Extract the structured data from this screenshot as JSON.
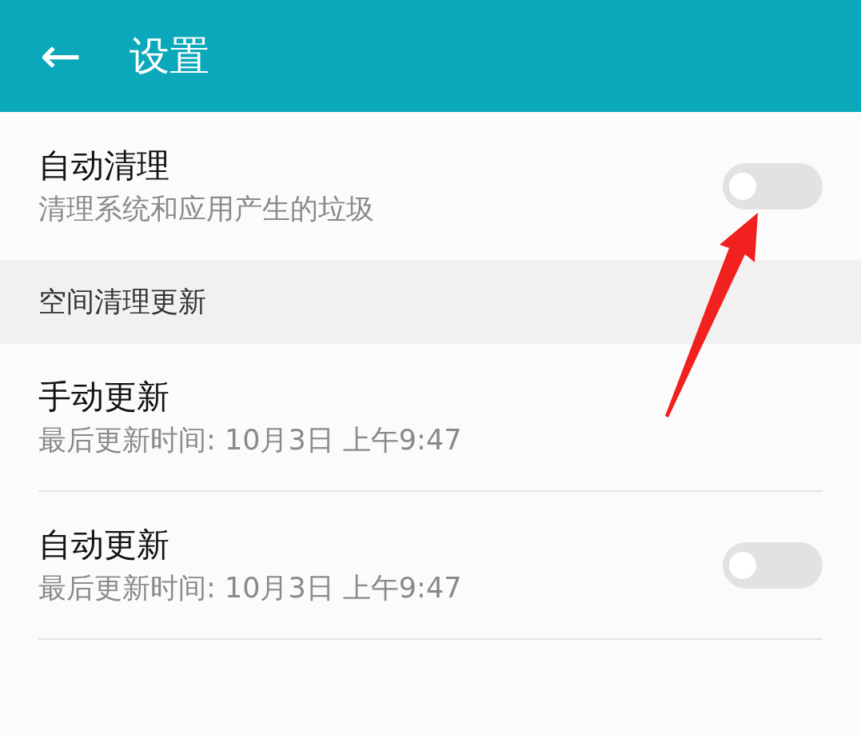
{
  "header": {
    "back": "←",
    "title": "设置"
  },
  "items": [
    {
      "kind": "toggle",
      "title": "自动清理",
      "subtitle": "清理系统和应用产生的垃圾",
      "on": false,
      "divider": false
    },
    {
      "kind": "section",
      "title": "空间清理更新"
    },
    {
      "kind": "plain",
      "title": "手动更新",
      "subtitle": "最后更新时间: 10月3日 上午9:47",
      "divider": true
    },
    {
      "kind": "toggle",
      "title": "自动更新",
      "subtitle": "最后更新时间: 10月3日 上午9:47",
      "on": false,
      "divider": true
    }
  ]
}
